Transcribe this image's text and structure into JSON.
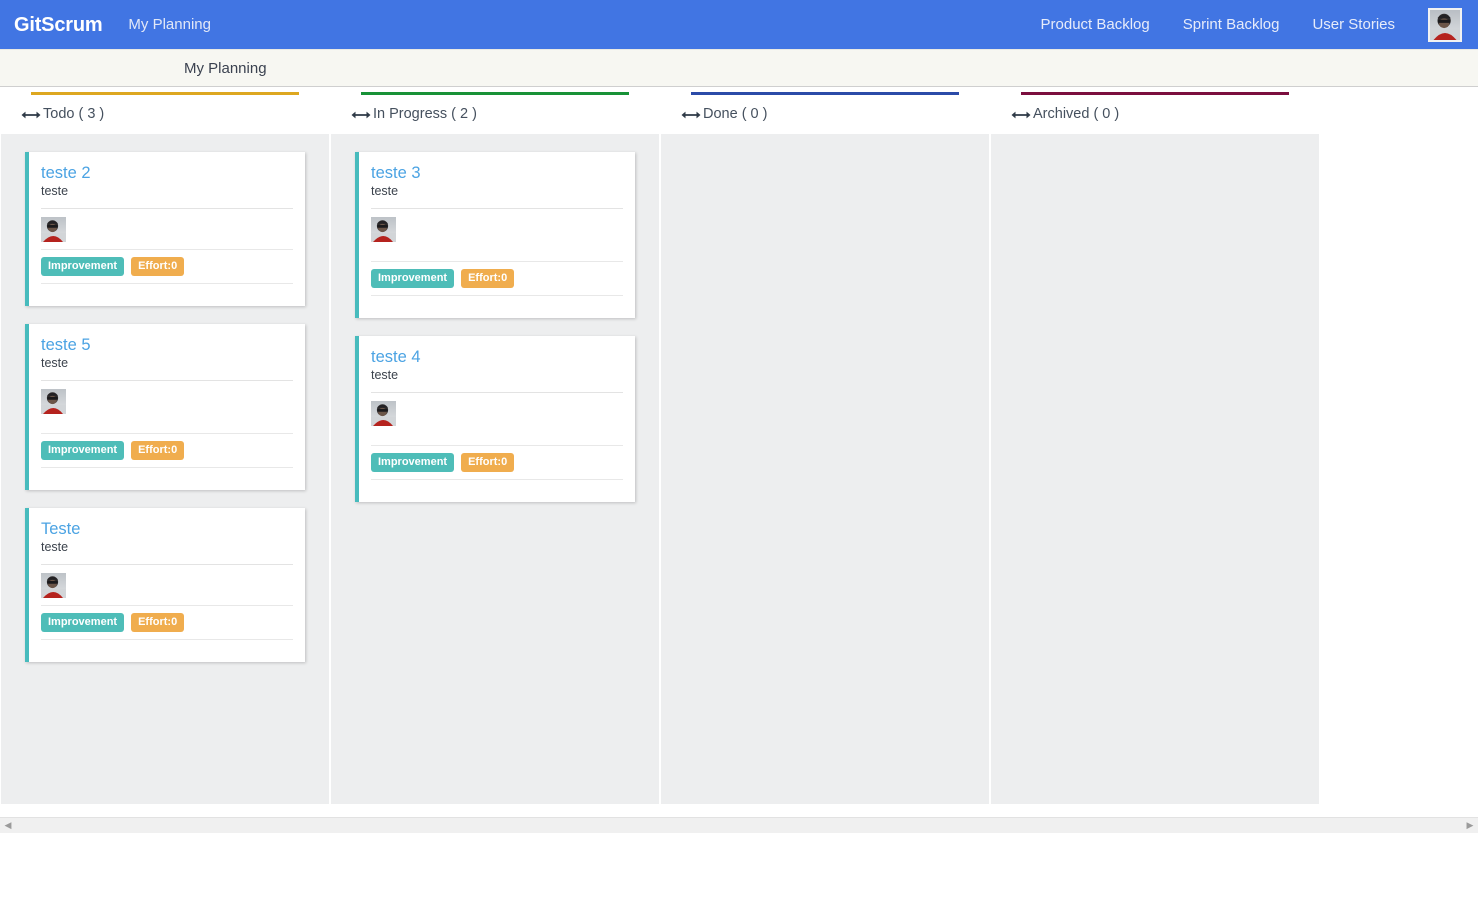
{
  "navbar": {
    "brand": "GitScrum",
    "left_link": "My Planning",
    "links": [
      "Product Backlog",
      "Sprint Backlog",
      "User Stories"
    ],
    "avatar_icon": "user-avatar",
    "background_color": "#4175E3"
  },
  "subbar": {
    "title": "My Planning"
  },
  "board": {
    "columns": [
      {
        "id": "todo",
        "title": "Todo ( 3 )",
        "name": "Todo",
        "count": 3,
        "accent_color": "#DDA720",
        "drag_icon": "arrows-horizontal-icon",
        "cards": [
          {
            "title": "teste 2",
            "description": "teste",
            "avatar_icon": "user-avatar",
            "tags": [
              {
                "label": "Improvement",
                "color": "#4EBDB8"
              },
              {
                "label": "Effort:0",
                "color": "#F0AD4E"
              }
            ],
            "tall_people": false
          },
          {
            "title": "teste 5",
            "description": "teste",
            "avatar_icon": "user-avatar",
            "tags": [
              {
                "label": "Improvement",
                "color": "#4EBDB8"
              },
              {
                "label": "Effort:0",
                "color": "#F0AD4E"
              }
            ],
            "tall_people": true
          },
          {
            "title": "Teste",
            "description": "teste",
            "avatar_icon": "user-avatar",
            "tags": [
              {
                "label": "Improvement",
                "color": "#4EBDB8"
              },
              {
                "label": "Effort:0",
                "color": "#F0AD4E"
              }
            ],
            "tall_people": false
          }
        ]
      },
      {
        "id": "in-progress",
        "title": "In Progress ( 2 )",
        "name": "In Progress",
        "count": 2,
        "accent_color": "#189237",
        "drag_icon": "arrows-horizontal-icon",
        "cards": [
          {
            "title": "teste 3",
            "description": "teste",
            "avatar_icon": "user-avatar",
            "tags": [
              {
                "label": "Improvement",
                "color": "#4EBDB8"
              },
              {
                "label": "Effort:0",
                "color": "#F0AD4E"
              }
            ],
            "tall_people": true
          },
          {
            "title": "teste 4",
            "description": "teste",
            "avatar_icon": "user-avatar",
            "tags": [
              {
                "label": "Improvement",
                "color": "#4EBDB8"
              },
              {
                "label": "Effort:0",
                "color": "#F0AD4E"
              }
            ],
            "tall_people": true
          }
        ]
      },
      {
        "id": "done",
        "title": "Done ( 0 )",
        "name": "Done",
        "count": 0,
        "accent_color": "#2B4BA8",
        "drag_icon": "arrows-horizontal-icon",
        "cards": []
      },
      {
        "id": "archived",
        "title": "Archived ( 0 )",
        "name": "Archived",
        "count": 0,
        "accent_color": "#7B0E3E",
        "drag_icon": "arrows-horizontal-icon",
        "cards": []
      }
    ]
  },
  "scrollbar": {
    "left_arrow": "◀",
    "right_arrow": "▶"
  }
}
